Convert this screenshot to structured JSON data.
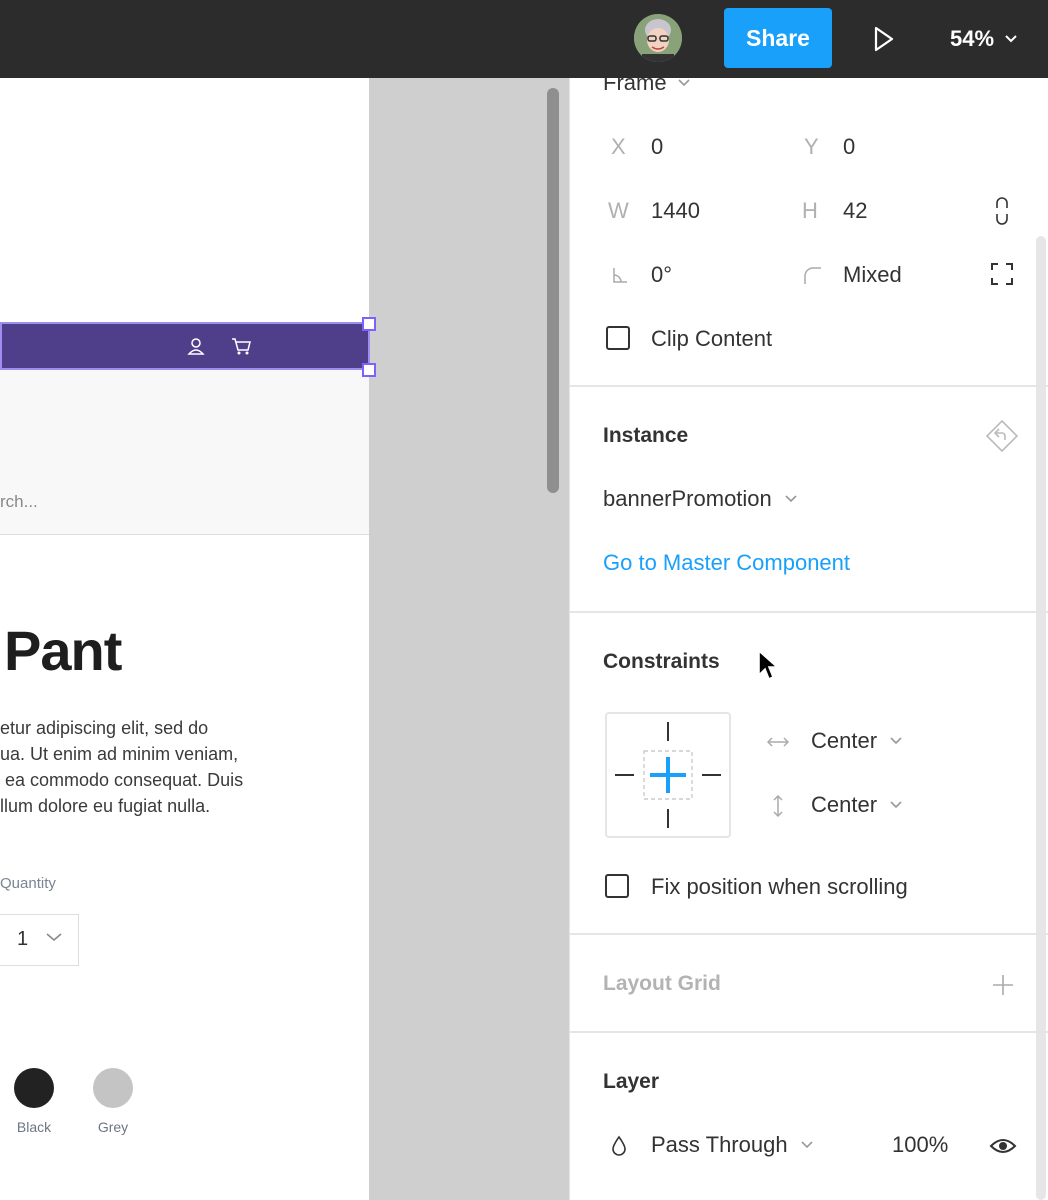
{
  "topbar": {
    "share_label": "Share",
    "zoom_label": "54%"
  },
  "canvas": {
    "search_placeholder": "rch...",
    "product_title": "Pant",
    "description_lines": [
      "etur adipiscing elit, sed do",
      "ua. Ut enim ad minim veniam,",
      " ea commodo consequat. Duis",
      "llum dolore eu fugiat nulla."
    ],
    "quantity_label": "Quantity",
    "quantity_value": "1",
    "swatches": [
      {
        "label": "Black",
        "color": "#222222"
      },
      {
        "label": "Grey",
        "color": "#c4c4c4"
      }
    ],
    "banner_color": "#4f3f8a"
  },
  "panel": {
    "frame_label": "Frame",
    "x_label": "X",
    "x_value": "0",
    "y_label": "Y",
    "y_value": "0",
    "w_label": "W",
    "w_value": "1440",
    "h_label": "H",
    "h_value": "42",
    "rotation_value": "0°",
    "radius_value": "Mixed",
    "clip_content_label": "Clip Content",
    "instance_title": "Instance",
    "instance_name": "bannerPromotion",
    "master_link": "Go to Master Component",
    "constraints_title": "Constraints",
    "horizontal_constraint": "Center",
    "vertical_constraint": "Center",
    "fix_position_label": "Fix position when scrolling",
    "layout_grid_title": "Layout Grid",
    "layer_title": "Layer",
    "blend_mode": "Pass Through",
    "opacity": "100%"
  },
  "colors": {
    "accent": "#18a0fb",
    "topbar": "#2c2c2c",
    "selection": "#7b61ff"
  },
  "icons": [
    "play-icon",
    "chevron-down-icon",
    "user-icon",
    "cart-icon",
    "constrain-proportions-icon",
    "independent-corners-icon",
    "detach-instance-icon",
    "plus-icon",
    "drop-icon",
    "eye-icon",
    "horizontal-arrows-icon",
    "vertical-arrows-icon"
  ]
}
